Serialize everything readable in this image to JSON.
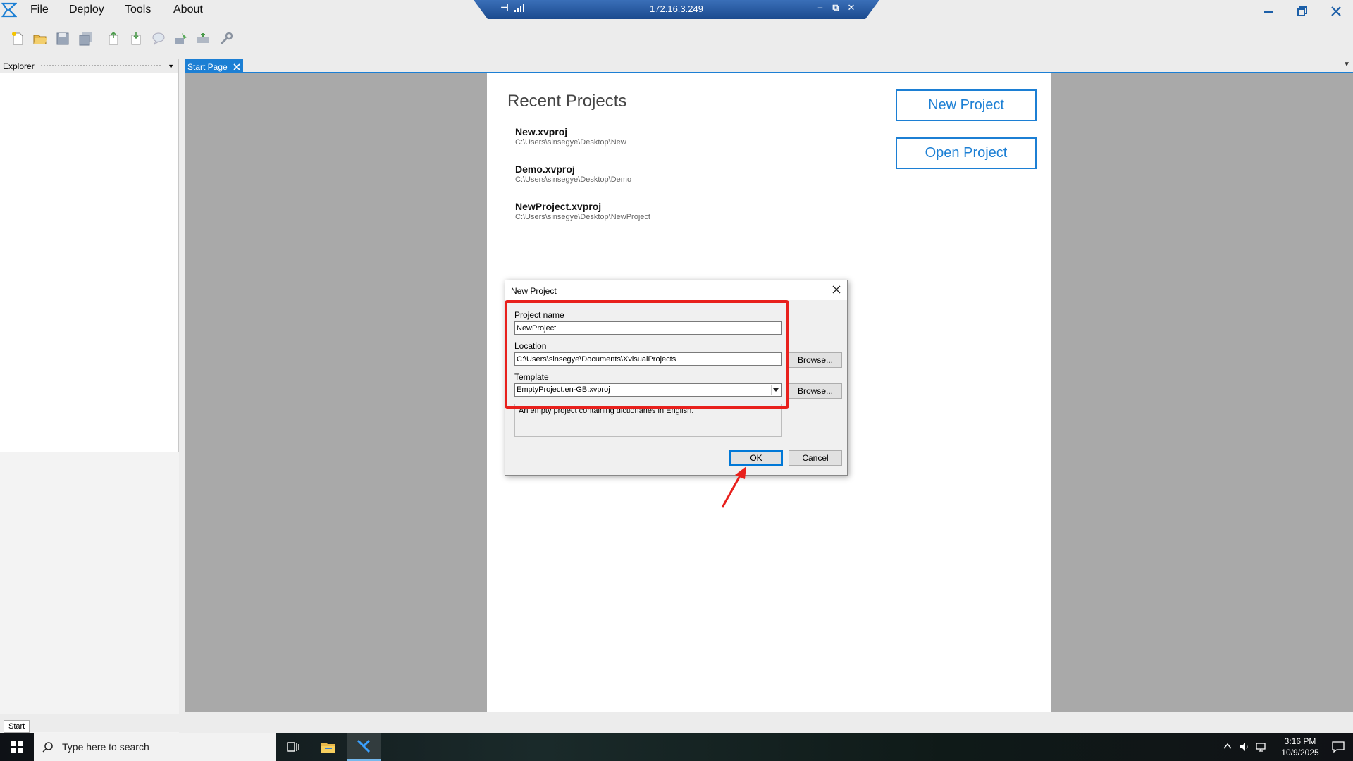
{
  "menu": {
    "items": [
      {
        "label": "File"
      },
      {
        "label": "Deploy"
      },
      {
        "label": "Tools"
      },
      {
        "label": "About"
      }
    ]
  },
  "remote_session": {
    "ip": "172.16.3.249"
  },
  "explorer": {
    "title": "Explorer"
  },
  "tabs": {
    "start_page": "Start Page"
  },
  "start_page": {
    "recent_title": "Recent Projects",
    "recent_projects": [
      {
        "name": "New.xvproj",
        "path": "C:\\Users\\sinsegye\\Desktop\\New"
      },
      {
        "name": "Demo.xvproj",
        "path": "C:\\Users\\sinsegye\\Desktop\\Demo"
      },
      {
        "name": "NewProject.xvproj",
        "path": "C:\\Users\\sinsegye\\Desktop\\NewProject"
      }
    ],
    "new_project_label": "New Project",
    "open_project_label": "Open Project"
  },
  "dialog": {
    "title": "New Project",
    "project_name_label": "Project name",
    "project_name_value": "NewProject",
    "location_label": "Location",
    "location_value": "C:\\Users\\sinsegye\\Documents\\XvisualProjects",
    "template_label": "Template",
    "template_value": "EmptyProject.en-GB.xvproj",
    "template_description": "An empty project containing dictionaries in English.",
    "browse_label": "Browse...",
    "ok_label": "OK",
    "cancel_label": "Cancel"
  },
  "statusbar": {
    "start_tab": "Start"
  },
  "taskbar": {
    "search_placeholder": "Type here to search",
    "time": "3:16 PM",
    "date": "10/9/2025"
  },
  "colors": {
    "accent": "#1c7fd4",
    "highlight": "#e8201c",
    "workspace": "#a9a9a9"
  }
}
